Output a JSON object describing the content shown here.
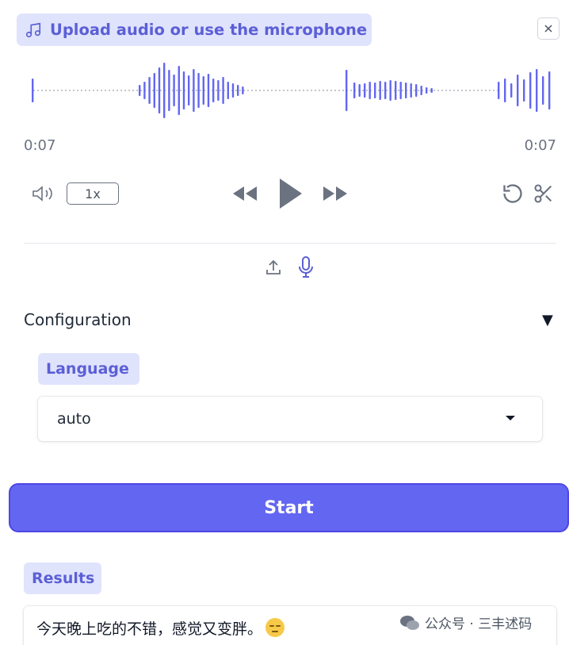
{
  "audio": {
    "upload_label": "Upload audio or use the microphone",
    "current_time": "0:07",
    "duration": "0:07",
    "speed": "1x"
  },
  "configuration": {
    "title": "Configuration",
    "language_label": "Language",
    "language_value": "auto"
  },
  "start_label": "Start",
  "results": {
    "label": "Results",
    "text": "今天晚上吃的不错，感觉又变胖。"
  },
  "watermark": "公众号 · 三丰述码",
  "colors": {
    "accent": "#6366f1",
    "chip_bg": "#e0e3fc",
    "chip_text": "#5b5fd6",
    "wave": "#6366f1"
  },
  "icons": [
    "music-note-icon",
    "close-icon",
    "volume-icon",
    "rewind-icon",
    "play-icon",
    "fast-forward-icon",
    "reset-icon",
    "scissors-icon",
    "upload-icon",
    "microphone-icon",
    "chevron-down-icon",
    "wechat-icon"
  ]
}
